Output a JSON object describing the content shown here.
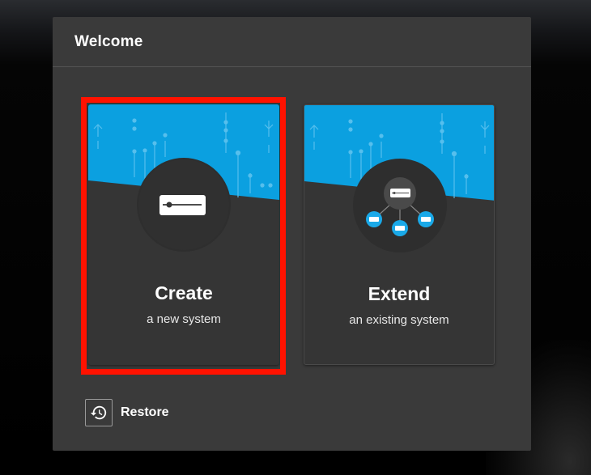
{
  "dialog": {
    "title": "Welcome"
  },
  "cards": {
    "create": {
      "title": "Create",
      "subtitle": "a new system",
      "icon": "server-icon"
    },
    "extend": {
      "title": "Extend",
      "subtitle": "an existing system",
      "icon": "network-nodes-icon"
    }
  },
  "restore": {
    "label": "Restore",
    "icon": "history-icon"
  },
  "colors": {
    "accent_blue": "#0ba0e0",
    "highlight_red": "#ff1200",
    "dialog_bg": "#3a3a3a",
    "card_bg": "#353535"
  }
}
